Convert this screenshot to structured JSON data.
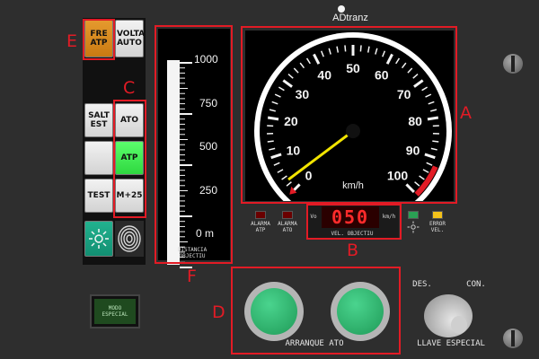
{
  "brand": "ADtranz",
  "callouts": {
    "a": "A",
    "b": "B",
    "c": "C",
    "d": "D",
    "e": "E",
    "f": "F"
  },
  "left_panel": {
    "fre_atp": "FRE ATP",
    "volta_auto": "VOLTA AUTO",
    "salt_est": "SALT EST",
    "ato": "ATO",
    "atp": "ATP",
    "test": "TEST",
    "m25": "M+25",
    "modo_especial": "MODO ESPECIAL"
  },
  "distance_gauge": {
    "ticks": [
      "1000",
      "750",
      "500",
      "250",
      "0 m"
    ],
    "label": "DISTANCIA OBJECTIU"
  },
  "speedometer": {
    "ticks": [
      "0",
      "10",
      "20",
      "30",
      "40",
      "50",
      "60",
      "70",
      "80",
      "90",
      "100"
    ],
    "unit": "km/h",
    "needle_value": 3,
    "max": 100
  },
  "indicators": {
    "alarma_atp": "ALARMA ATP",
    "alarma_ato": "ALARMA ATO",
    "error_vel": "ERROR VEL.",
    "vo": "Vo",
    "target_speed": "050",
    "unit": "km/h",
    "vel_label": "VEL. OBJECTIU"
  },
  "start_buttons": {
    "label": "ARRANQUE ATO"
  },
  "key_switch": {
    "des": "DES.",
    "con": "CON.",
    "label": "LLAVE ESPECIAL"
  },
  "colors": {
    "accent_red": "#e21b25",
    "needle": "#f2e400",
    "digital": "#ff2b2b"
  }
}
